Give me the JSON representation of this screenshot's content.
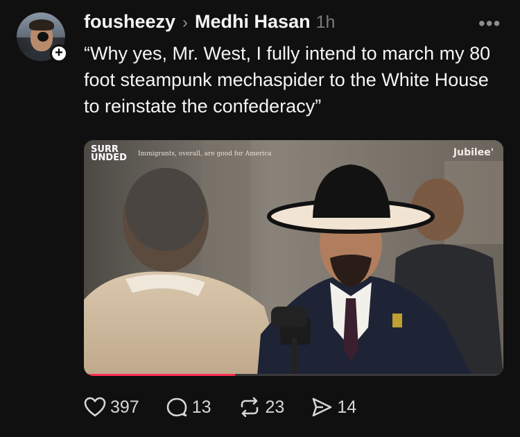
{
  "post": {
    "username": "fousheezy",
    "reply_to": "Medhi Hasan",
    "time": "1h",
    "more": "•••",
    "text": "“Why yes, Mr. West, I fully intend to march my 80 foot steampunk mechaspider to the White House to reinstate the confederacy”"
  },
  "media": {
    "brand_line1": "SURR",
    "brand_line2": "UNDED",
    "caption": "Immigrants, overall, are good for America",
    "watermark": "Jubilee'",
    "progress": 0.36
  },
  "actions": {
    "likes": "397",
    "replies": "13",
    "reposts": "23",
    "shares": "14"
  },
  "icons": {
    "like": "heart-icon",
    "reply": "comment-icon",
    "repost": "repost-icon",
    "share": "send-icon",
    "follow": "plus-icon",
    "menu": "more-icon"
  },
  "colors": {
    "background": "#101010",
    "text": "#f3f5f7",
    "muted": "#7a7a7a",
    "progress": "#ff2d55"
  }
}
